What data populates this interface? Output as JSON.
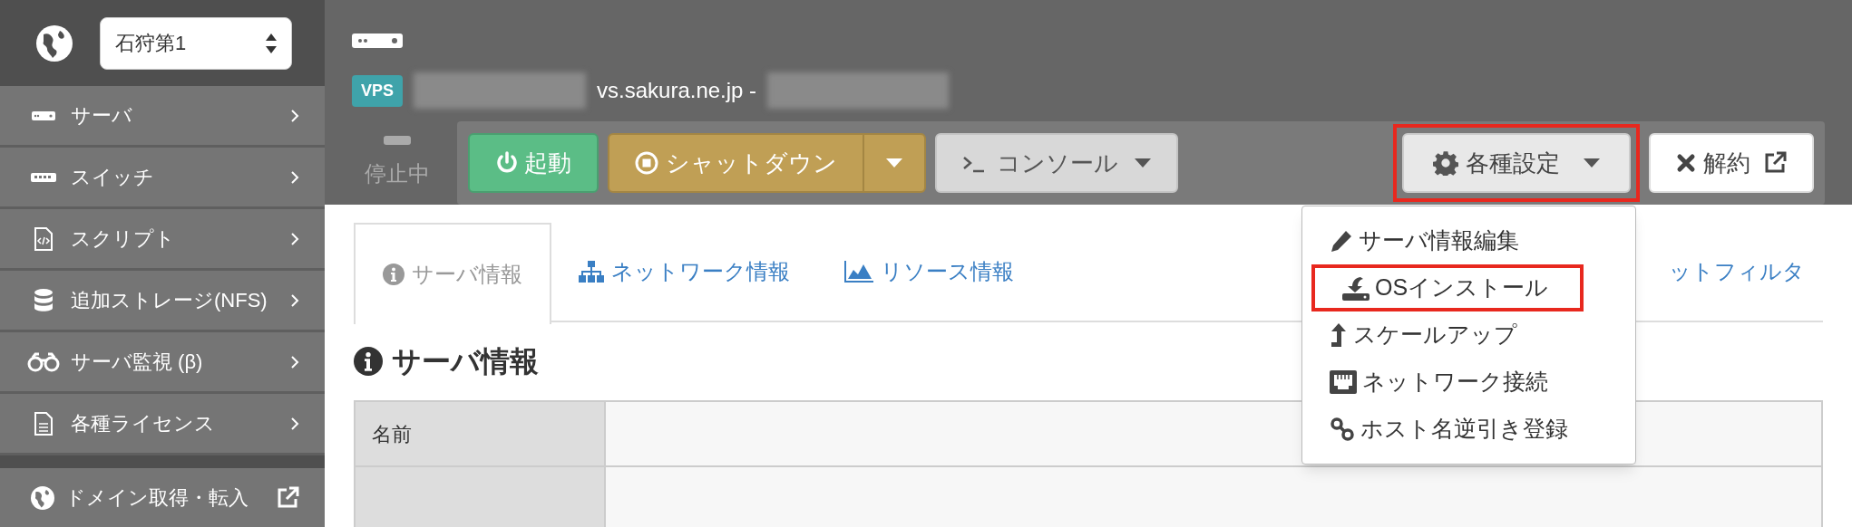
{
  "sidebar": {
    "region_select": {
      "value": "石狩第1"
    },
    "items": [
      {
        "label": "サーバ",
        "kind": "server"
      },
      {
        "label": "スイッチ",
        "kind": "switch"
      },
      {
        "label": "スクリプト",
        "kind": "script"
      },
      {
        "label": "追加ストレージ(NFS)",
        "kind": "storage"
      },
      {
        "label": "サーバ監視 (β)",
        "kind": "monitor"
      },
      {
        "label": "各種ライセンス",
        "kind": "license"
      }
    ],
    "external_link": {
      "label": "ドメイン取得・転入"
    }
  },
  "server": {
    "type_badge": "VPS",
    "hostname": "vs.sakura.ne.jp -",
    "status": "停止中"
  },
  "toolbar": {
    "buttons": [
      {
        "label": "起動",
        "kind": "start",
        "highlighted": false
      },
      {
        "label": "シャットダウン",
        "kind": "shutdown",
        "highlighted": false
      },
      {
        "label": "コンソール",
        "kind": "console",
        "highlighted": false
      },
      {
        "label": "各種設定",
        "kind": "settings",
        "highlighted": true
      },
      {
        "label": "解約",
        "kind": "cancel",
        "highlighted": false
      }
    ]
  },
  "settings_menu": {
    "items": [
      {
        "label": "サーバ情報編集",
        "kind": "edit",
        "highlighted": false
      },
      {
        "label": "OSインストール",
        "kind": "install",
        "highlighted": true
      },
      {
        "label": "スケールアップ",
        "kind": "scale",
        "highlighted": false
      },
      {
        "label": "ネットワーク接続",
        "kind": "network",
        "highlighted": false
      },
      {
        "label": "ホスト名逆引き登録",
        "kind": "link",
        "highlighted": false
      }
    ]
  },
  "tabs": [
    {
      "label": "サーバ情報",
      "kind": "info",
      "selected": true
    },
    {
      "label": "ネットワーク情報",
      "kind": "network",
      "selected": false
    },
    {
      "label": "リソース情報",
      "kind": "resource",
      "selected": false
    },
    {
      "label": "ットフィルタ",
      "kind": "plain",
      "selected": false
    }
  ],
  "section_title": "サーバ情報",
  "table": {
    "rows": [
      {
        "label": "名前"
      }
    ]
  }
}
